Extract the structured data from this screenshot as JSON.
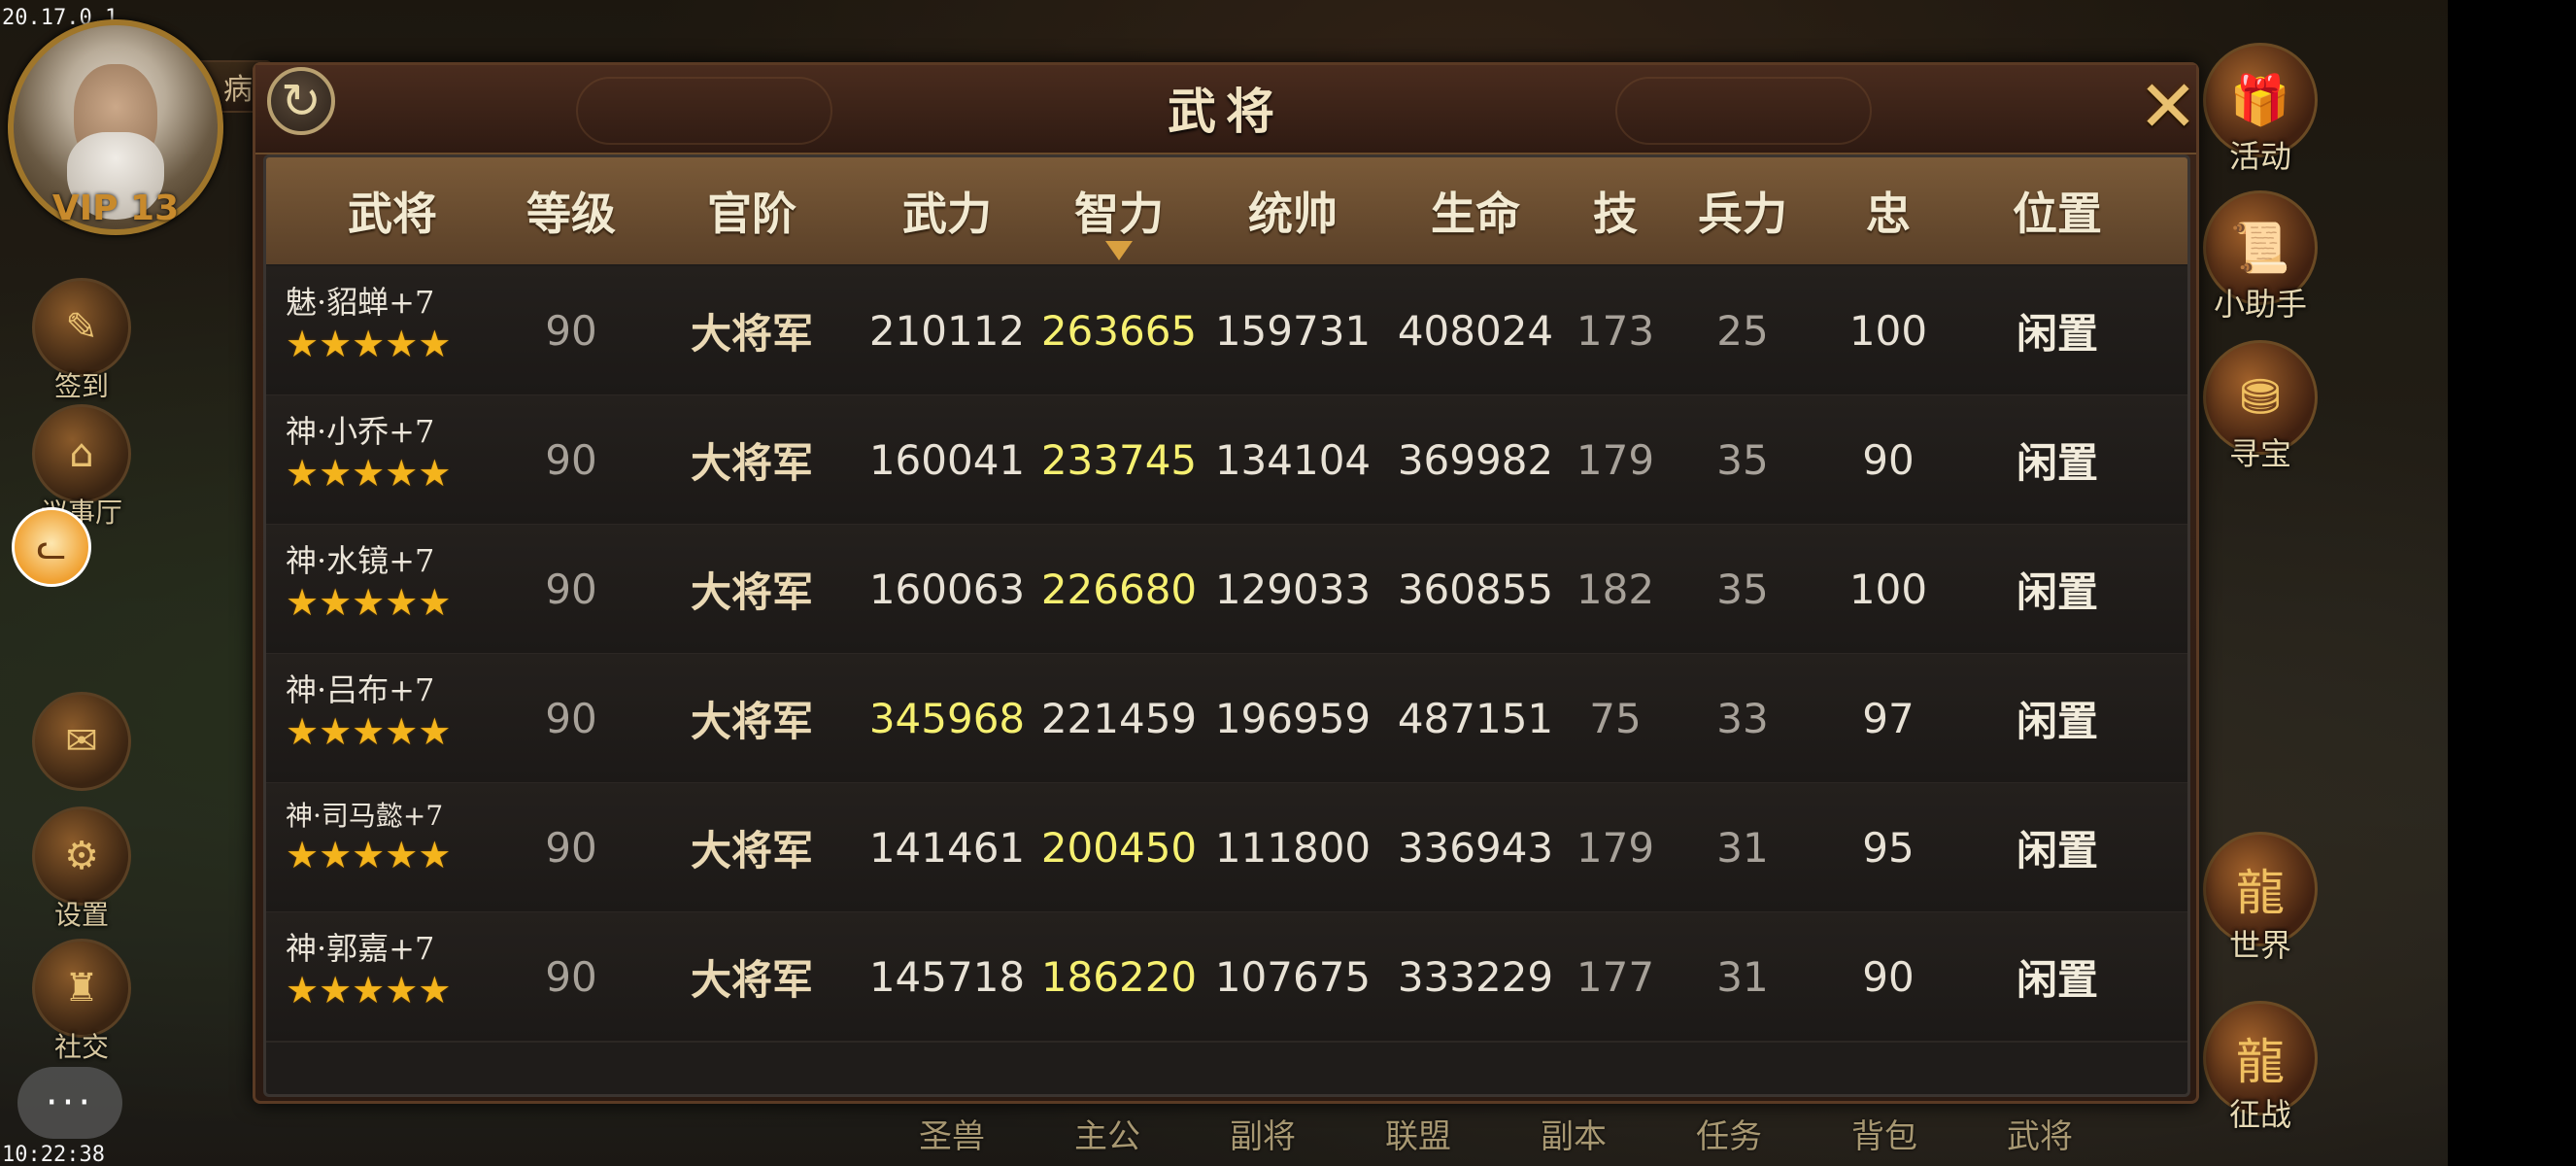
{
  "status": {
    "ip": "20.17.0.1",
    "time": "10:22:38"
  },
  "player": {
    "vip": "VIP 13",
    "bing_label": "病"
  },
  "left_menu": [
    {
      "label": "签到",
      "icon": "sign-in-icon"
    },
    {
      "label": "议事厅",
      "icon": "council-hall-icon"
    },
    {
      "label": "",
      "icon": "mail-icon"
    },
    {
      "label": "设置",
      "icon": "settings-gear-icon"
    },
    {
      "label": "社交",
      "icon": "social-icon"
    }
  ],
  "right_menu": [
    {
      "label": "活动",
      "icon": "gift-icon"
    },
    {
      "label": "小助手",
      "icon": "scroll-icon"
    },
    {
      "label": "寻宝",
      "icon": "treasure-chest-icon"
    },
    {
      "label": "世界",
      "icon": "dragon-world-icon"
    },
    {
      "label": "征战",
      "icon": "dragon-campaign-icon"
    }
  ],
  "bottom_menu": [
    "圣兽",
    "主公",
    "副将",
    "联盟",
    "副本",
    "任务",
    "背包",
    "武将"
  ],
  "chat_button": "···",
  "dialog": {
    "title": "武将",
    "refresh_icon": "refresh-icon",
    "close_icon": "close-icon",
    "columns": [
      "武将",
      "等级",
      "官阶",
      "武力",
      "智力",
      "统帅",
      "生命",
      "技",
      "兵力",
      "忠",
      "位置"
    ],
    "sorted_column": "智力",
    "rows": [
      {
        "name": "魅·貂蝉+7",
        "stars": 5,
        "level": "90",
        "rank": "大将军",
        "force": "210112",
        "intellect": "263665",
        "command": "159731",
        "life": "408024",
        "skill": "173",
        "troops": "25",
        "loyalty": "100",
        "position": "闲置",
        "highlight": "intellect"
      },
      {
        "name": "神·小乔+7",
        "stars": 5,
        "level": "90",
        "rank": "大将军",
        "force": "160041",
        "intellect": "233745",
        "command": "134104",
        "life": "369982",
        "skill": "179",
        "troops": "35",
        "loyalty": "90",
        "position": "闲置",
        "highlight": "intellect"
      },
      {
        "name": "神·水镜+7",
        "stars": 5,
        "level": "90",
        "rank": "大将军",
        "force": "160063",
        "intellect": "226680",
        "command": "129033",
        "life": "360855",
        "skill": "182",
        "troops": "35",
        "loyalty": "100",
        "position": "闲置",
        "highlight": "intellect"
      },
      {
        "name": "神·吕布+7",
        "stars": 5,
        "level": "90",
        "rank": "大将军",
        "force": "345968",
        "intellect": "221459",
        "command": "196959",
        "life": "487151",
        "skill": "75",
        "troops": "33",
        "loyalty": "97",
        "position": "闲置",
        "highlight": "force"
      },
      {
        "name": "神·司马懿+7",
        "stars": 5,
        "level": "90",
        "rank": "大将军",
        "force": "141461",
        "intellect": "200450",
        "command": "111800",
        "life": "336943",
        "skill": "179",
        "troops": "31",
        "loyalty": "95",
        "position": "闲置",
        "highlight": "intellect"
      },
      {
        "name": "神·郭嘉+7",
        "stars": 5,
        "level": "90",
        "rank": "大将军",
        "force": "145718",
        "intellect": "186220",
        "command": "107675",
        "life": "333229",
        "skill": "177",
        "troops": "31",
        "loyalty": "90",
        "position": "闲置",
        "highlight": "intellect"
      }
    ]
  },
  "colors": {
    "highlight": "#f6f070",
    "star": "#f4b41c",
    "header_bg": "#7a5a38"
  }
}
